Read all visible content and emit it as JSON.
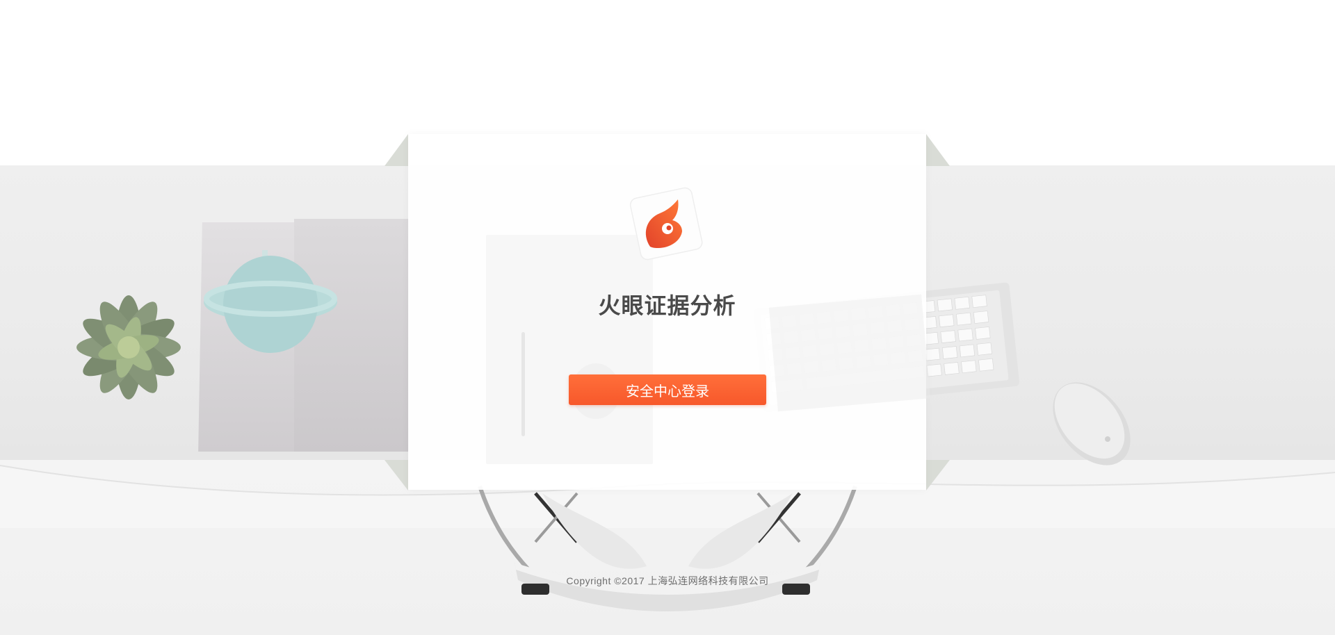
{
  "app": {
    "title": "火眼证据分析",
    "login_button_label": "安全中心登录",
    "logo_icon": "flame-eye-logo-icon"
  },
  "footer": {
    "copyright": "Copyright ©2017 上海弘连网络科技有限公司"
  },
  "colors": {
    "accent": "#f7582b",
    "accent_light": "#ff6f3a",
    "title_text": "#4a4a4a",
    "footer_text": "#6e6e6e"
  }
}
